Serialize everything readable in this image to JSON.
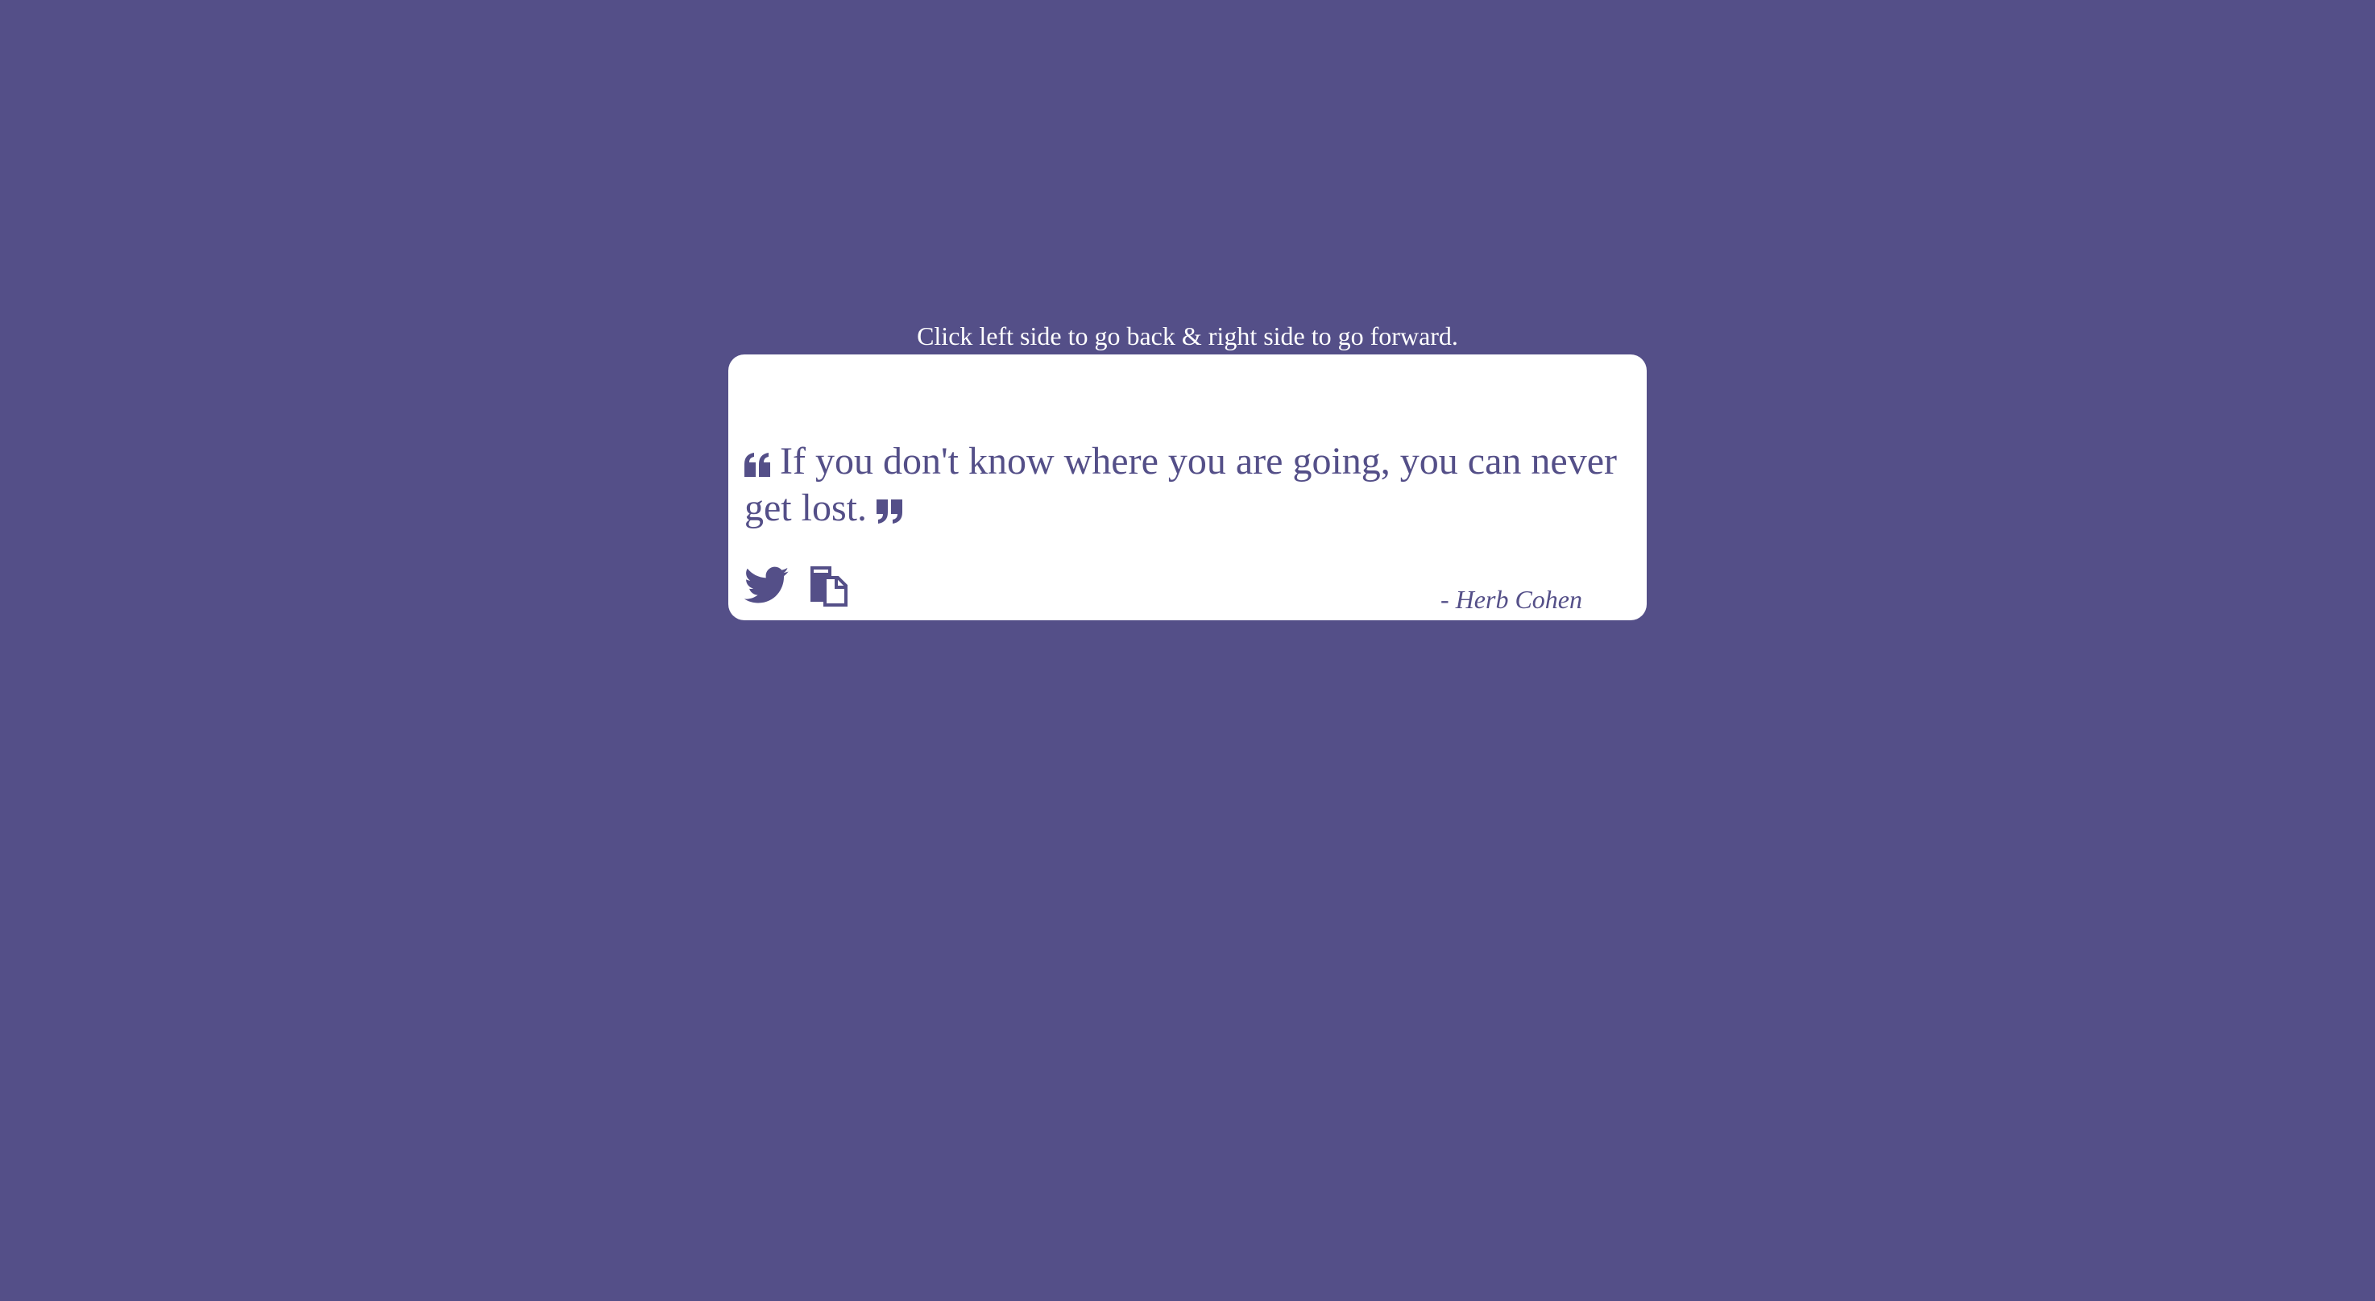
{
  "hint": {
    "text": "Click left side to go back & right side to go forward."
  },
  "quote": {
    "text": "If you don't know where you are going, you can never get lost.",
    "author": "- Herb Cohen",
    "open_icon": "quote-left-icon",
    "close_icon": "quote-right-icon"
  },
  "actions": {
    "tweet_icon": "twitter-icon",
    "copy_icon": "copy-icon"
  },
  "colors": {
    "background": "#544f88",
    "card": "#ffffff",
    "accent": "#544f88"
  }
}
